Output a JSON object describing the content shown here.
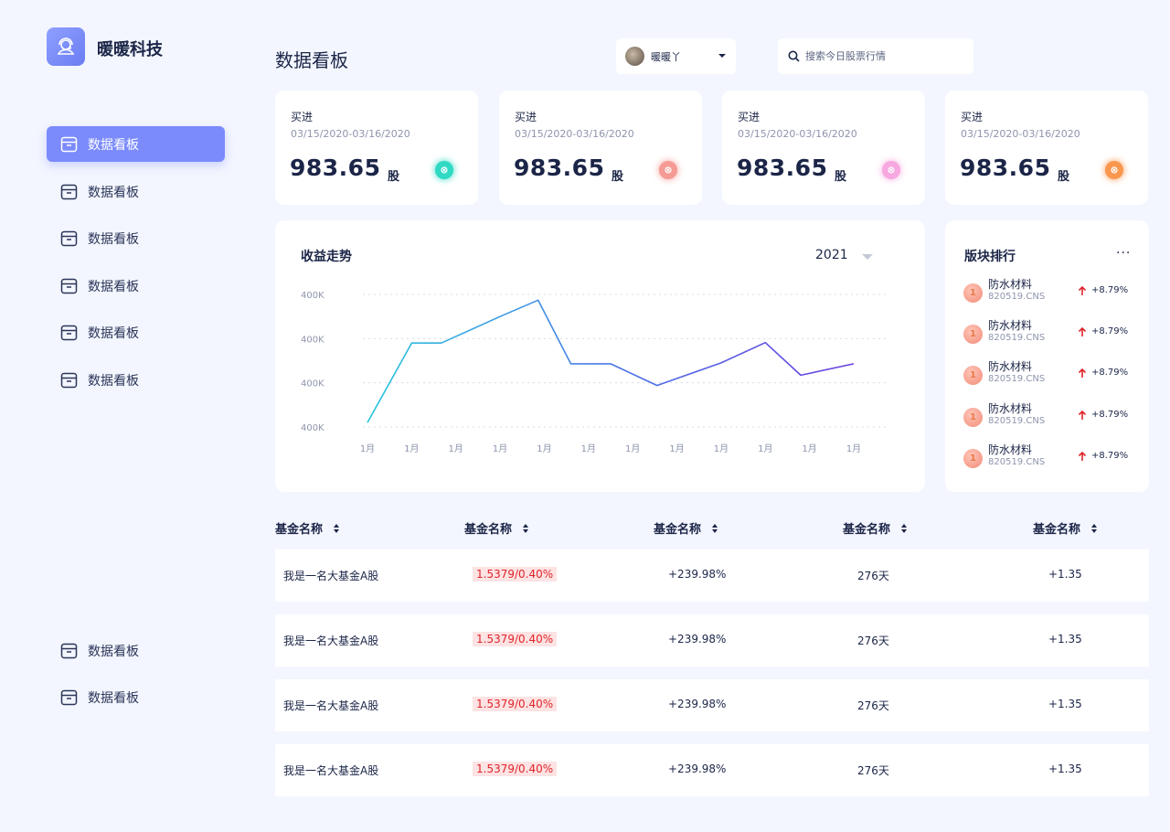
{
  "brand": {
    "name": "暖暖科技"
  },
  "sidebar": {
    "items": [
      {
        "label": "数据看板",
        "active": true
      },
      {
        "label": "数据看板"
      },
      {
        "label": "数据看板"
      },
      {
        "label": "数据看板"
      },
      {
        "label": "数据看板"
      },
      {
        "label": "数据看板"
      }
    ],
    "bottom_items": [
      {
        "label": "数据看板"
      },
      {
        "label": "数据看板"
      }
    ]
  },
  "header": {
    "title": "数据看板",
    "user": {
      "name": "暖暖丫"
    },
    "search": {
      "placeholder": "搜索今日股票行情"
    }
  },
  "stats": [
    {
      "label": "买进",
      "date": "03/15/2020-03/16/2020",
      "value": "983.65",
      "unit": "股",
      "color": "#2fd9c3"
    },
    {
      "label": "买进",
      "date": "03/15/2020-03/16/2020",
      "value": "983.65",
      "unit": "股",
      "color": "#f59a94"
    },
    {
      "label": "买进",
      "date": "03/15/2020-03/16/2020",
      "value": "983.65",
      "unit": "股",
      "color": "#f7a8e0"
    },
    {
      "label": "买进",
      "date": "03/15/2020-03/16/2020",
      "value": "983.65",
      "unit": "股",
      "color": "#f9974f"
    }
  ],
  "chart_data": {
    "type": "line",
    "title": "收益走势",
    "year": "2021",
    "categories": [
      "1月",
      "1月",
      "1月",
      "1月",
      "1月",
      "1月",
      "1月",
      "1月",
      "1月",
      "1月",
      "1月",
      "1月"
    ],
    "y_tick_labels": [
      "400K",
      "400K",
      "400K",
      "400K"
    ],
    "series_points": [
      [
        0,
        0.1
      ],
      [
        1,
        1.9
      ],
      [
        1.67,
        1.9
      ],
      [
        3,
        2.5
      ],
      [
        3.86,
        2.87
      ],
      [
        4.6,
        1.43
      ],
      [
        5.5,
        1.43
      ],
      [
        6.55,
        0.94
      ],
      [
        8,
        1.45
      ],
      [
        9,
        1.91
      ],
      [
        9.8,
        1.17
      ],
      [
        11,
        1.43
      ]
    ],
    "ylim": [
      0,
      3
    ],
    "grid": true,
    "colors": [
      "#2ac6de",
      "#4a78e6",
      "#6a3fe0"
    ]
  },
  "ranking": {
    "title": "版块排行",
    "more": "···",
    "items": [
      {
        "rank": "1",
        "name": "防水材料",
        "code": "820519.CNS",
        "change": "+8.79%"
      },
      {
        "rank": "1",
        "name": "防水材料",
        "code": "820519.CNS",
        "change": "+8.79%"
      },
      {
        "rank": "1",
        "name": "防水材料",
        "code": "820519.CNS",
        "change": "+8.79%"
      },
      {
        "rank": "1",
        "name": "防水材料",
        "code": "820519.CNS",
        "change": "+8.79%"
      },
      {
        "rank": "1",
        "name": "防水材料",
        "code": "820519.CNS",
        "change": "+8.79%"
      }
    ]
  },
  "table": {
    "headers": [
      "基金名称",
      "基金名称",
      "基金名称",
      "基金名称",
      "基金名称"
    ],
    "rows": [
      [
        "我是一名大基金A股",
        "1.5379/0.40%",
        "+239.98%",
        "276天",
        "+1.35"
      ],
      [
        "我是一名大基金A股",
        "1.5379/0.40%",
        "+239.98%",
        "276天",
        "+1.35"
      ],
      [
        "我是一名大基金A股",
        "1.5379/0.40%",
        "+239.98%",
        "276天",
        "+1.35"
      ],
      [
        "我是一名大基金A股",
        "1.5379/0.40%",
        "+239.98%",
        "276天",
        "+1.35"
      ]
    ]
  }
}
